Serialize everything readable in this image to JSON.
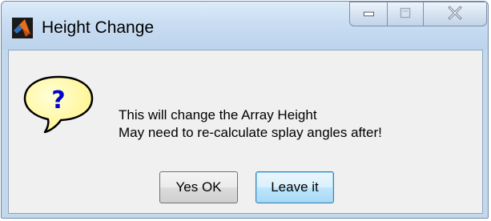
{
  "window": {
    "title": "Height Change",
    "app_icon": "matlab-icon",
    "controls": {
      "minimize_icon": "minimize-icon",
      "maximize_icon": "maximize-icon",
      "close_icon": "close-icon"
    }
  },
  "dialog": {
    "icon": "question-icon",
    "message_lines": [
      "This will change the Array Height",
      "May need to re-calculate splay angles after!"
    ],
    "buttons": {
      "yes_label": "Yes OK",
      "leave_label": "Leave it"
    }
  },
  "colors": {
    "titlebar": "#c9ddf2",
    "client_background": "#f0f0f0",
    "question_bubble": "#ffff99",
    "question_mark": "#0000cc"
  }
}
